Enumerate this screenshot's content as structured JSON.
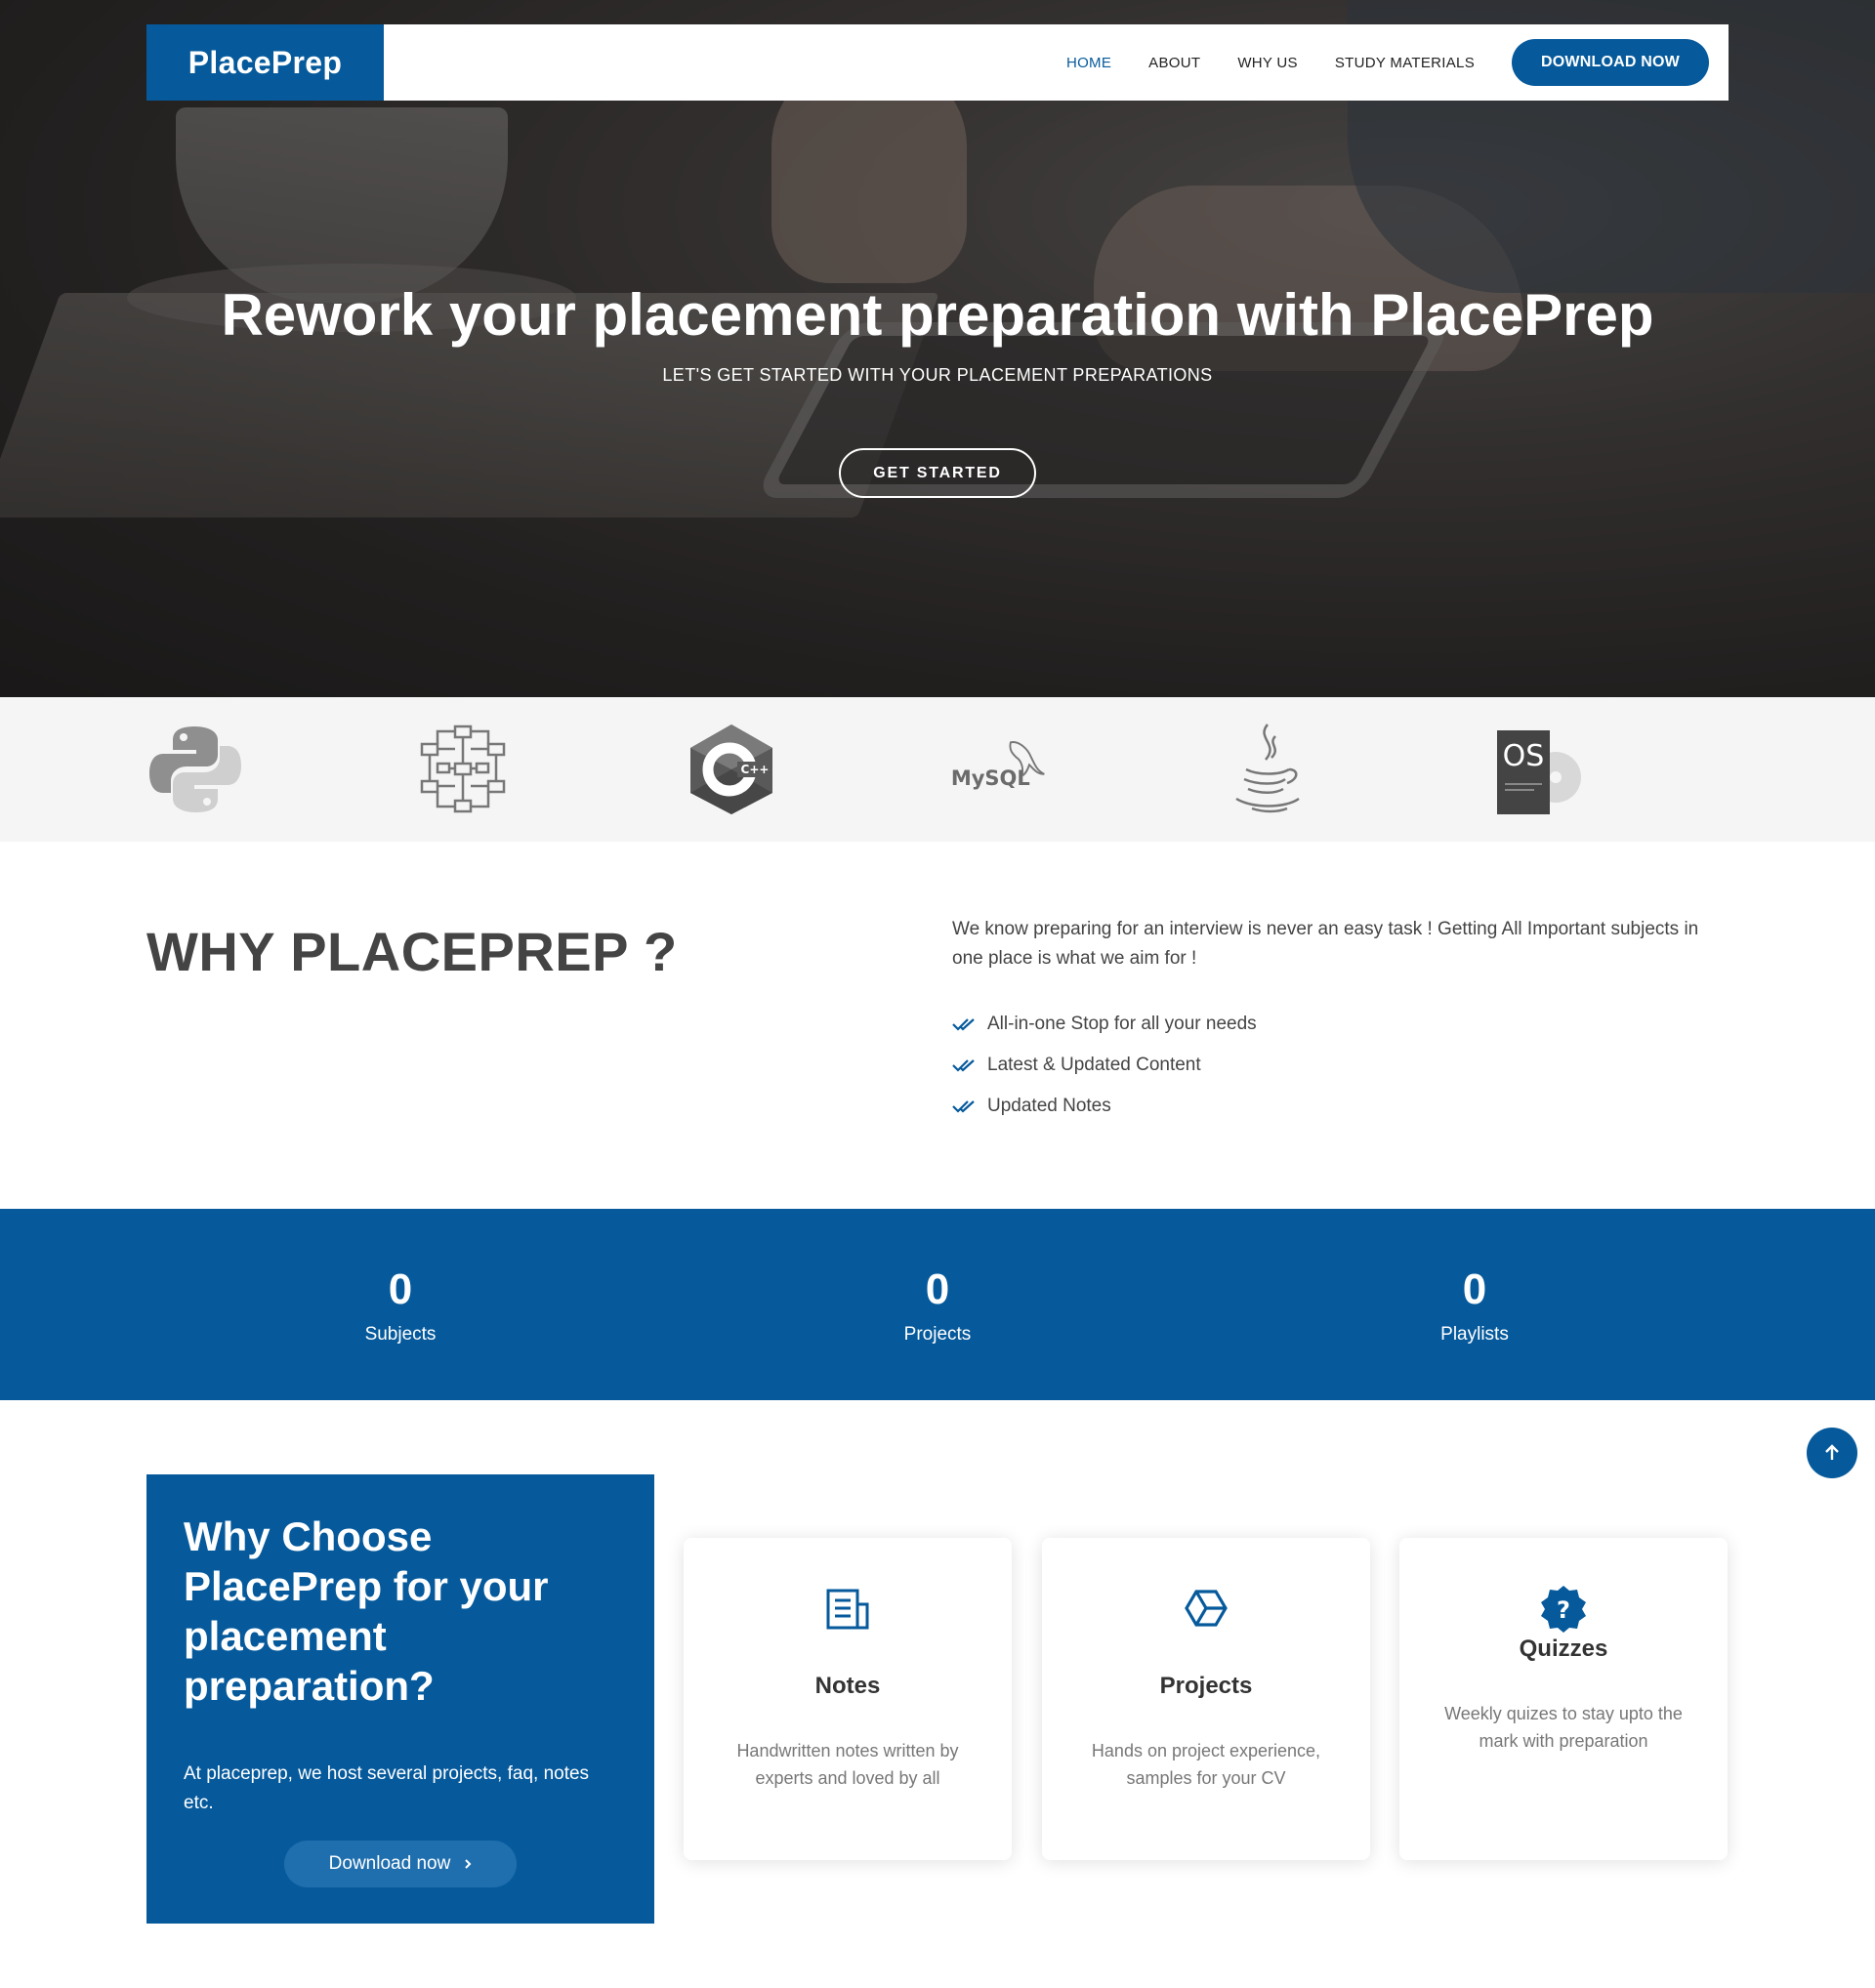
{
  "brand": {
    "name": "PlacePrep",
    "accent": "#065a9c"
  },
  "nav": {
    "items": [
      {
        "label": "HOME",
        "active": true
      },
      {
        "label": "ABOUT",
        "active": false
      },
      {
        "label": "WHY US",
        "active": false
      },
      {
        "label": "STUDY MATERIALS",
        "active": false
      }
    ],
    "cta": "DOWNLOAD NOW"
  },
  "hero": {
    "title": "Rework your placement preparation with PlacePrep",
    "subtitle": "LET'S GET STARTED WITH YOUR PLACEMENT PREPARATIONS",
    "button": "GET STARTED"
  },
  "logos": [
    {
      "icon": "python-icon"
    },
    {
      "icon": "network-icon"
    },
    {
      "icon": "cpp-icon",
      "text": "C++"
    },
    {
      "icon": "mysql-icon",
      "text": "MySQL"
    },
    {
      "icon": "java-icon"
    },
    {
      "icon": "os-icon",
      "text": "OS"
    }
  ],
  "why": {
    "title": "WHY PLACEPREP ?",
    "intro": "We know preparing for an interview is never an easy task ! Getting All Important subjects in one place is what we aim for !",
    "points": [
      "All-in-one Stop for all your needs",
      "Latest & Updated Content",
      "Updated Notes"
    ]
  },
  "counts": [
    {
      "value": "0",
      "label": "Subjects"
    },
    {
      "value": "0",
      "label": "Projects"
    },
    {
      "value": "0",
      "label": "Playlists"
    }
  ],
  "choose": {
    "title": "Why Choose PlacePrep for your placement preparation?",
    "text": "At placeprep, we host several projects, faq, notes etc.",
    "button": "Download now",
    "button_icon": "chevron-right-icon"
  },
  "features": [
    {
      "icon": "notes-icon",
      "title": "Notes",
      "desc": "Handwritten notes written by experts and loved by all"
    },
    {
      "icon": "hexagon-icon",
      "title": "Projects",
      "desc": "Hands on project experience, samples for your CV"
    },
    {
      "icon": "question-badge-icon",
      "title": "Quizzes",
      "desc": "Weekly quizes to stay upto the mark with preparation"
    }
  ]
}
